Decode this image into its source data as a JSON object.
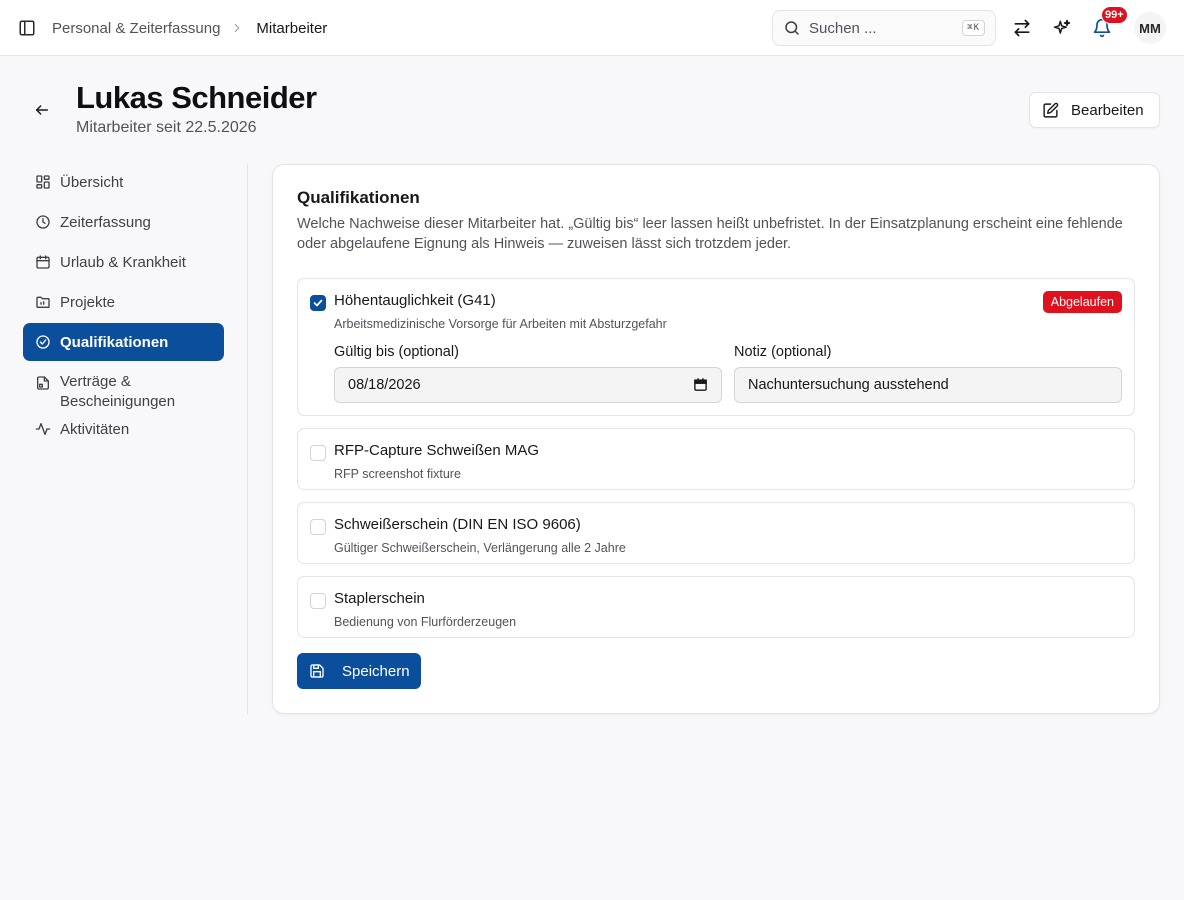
{
  "breadcrumb": {
    "parent": "Personal & Zeiterfassung",
    "current": "Mitarbeiter"
  },
  "search": {
    "placeholder": "Suchen ...",
    "shortcut": "⌘K"
  },
  "notifications": {
    "badge": "99+"
  },
  "user": {
    "initials": "MM"
  },
  "header": {
    "title": "Lukas Schneider",
    "subtitle": "Mitarbeiter seit 22.5.2026",
    "edit_label": "Bearbeiten"
  },
  "nav": {
    "items": [
      {
        "label": "Übersicht",
        "icon": "layout-grid-icon"
      },
      {
        "label": "Zeiterfassung",
        "icon": "clock-icon"
      },
      {
        "label": "Urlaub & Krankheit",
        "icon": "calendar-icon"
      },
      {
        "label": "Projekte",
        "icon": "folder-icon"
      },
      {
        "label": "Qualifikationen",
        "icon": "check-circle-icon",
        "active": true
      },
      {
        "label": "Verträge & Bescheinigungen",
        "icon": "file-icon"
      },
      {
        "label": "Aktivitäten",
        "icon": "activity-icon"
      }
    ]
  },
  "qualifications": {
    "title": "Qualifikationen",
    "description": "Welche Nachweise dieser Mitarbeiter hat. „Gültig bis“ leer lassen heißt unbefristet. In der Einsatzplanung erscheint eine fehlende oder abgelaufene Eignung als Hinweis — zuweisen lässt sich trotzdem jeder.",
    "items": [
      {
        "name": "Höhentauglichkeit (G41)",
        "description": "Arbeitsmedizinische Vorsorge für Arbeiten mit Absturzgefahr",
        "checked": true,
        "status": "Abgelaufen",
        "valid_until_label": "Gültig bis (optional)",
        "valid_until": "08/18/2026",
        "note_label": "Notiz (optional)",
        "note": "Nachuntersuchung ausstehend"
      },
      {
        "name": "RFP-Capture Schweißen MAG",
        "description": "RFP screenshot fixture",
        "checked": false
      },
      {
        "name": "Schweißerschein (DIN EN ISO 9606)",
        "description": "Gültiger Schweißerschein, Verlängerung alle 2 Jahre",
        "checked": false
      },
      {
        "name": "Staplerschein",
        "description": "Bedienung von Flurförderzeugen",
        "checked": false
      }
    ],
    "save_label": "Speichern"
  },
  "colors": {
    "primary": "#0b4f9c",
    "danger": "#e0111f",
    "background": "#f8f8fa"
  }
}
